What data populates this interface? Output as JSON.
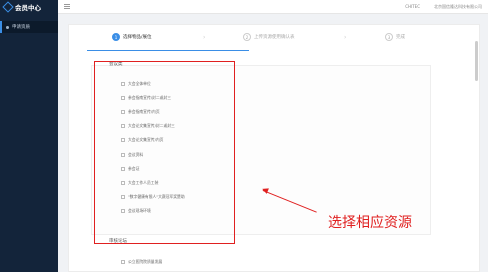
{
  "sidebar": {
    "brand": "会员中心",
    "items": [
      {
        "label": "申请资质"
      }
    ]
  },
  "topbar": {
    "right_items": [
      "CHITEC",
      "北京国信隆达科技有限公司"
    ]
  },
  "steps": [
    {
      "index": "1",
      "label": "选择物品/展位",
      "active": true
    },
    {
      "index": "2",
      "label": "上传资源使用确认表",
      "active": false
    },
    {
      "index": "3",
      "label": "完成",
      "active": false
    }
  ],
  "sections": [
    {
      "title": "会议类"
    },
    {
      "title": "审核论坛"
    }
  ],
  "items": [
    "大会全体单位",
    "参会指南宣传/封二或封三",
    "参会指南宣传/内页",
    "大会论文集宣传/封二或封三",
    "大会论文集宣传/内页",
    "会议资料",
    "参会证",
    "大会工作人员工装",
    "\"数字健康有限人\"大赛冠军奖赞助",
    "会议现场环境"
  ],
  "bottom_items": [
    "公立医院院质量发展"
  ],
  "annotation": {
    "text": "选择相应资源",
    "color": "#e02020"
  },
  "colors": {
    "accent": "#3a8ee6",
    "sidebar": "#13243a"
  }
}
